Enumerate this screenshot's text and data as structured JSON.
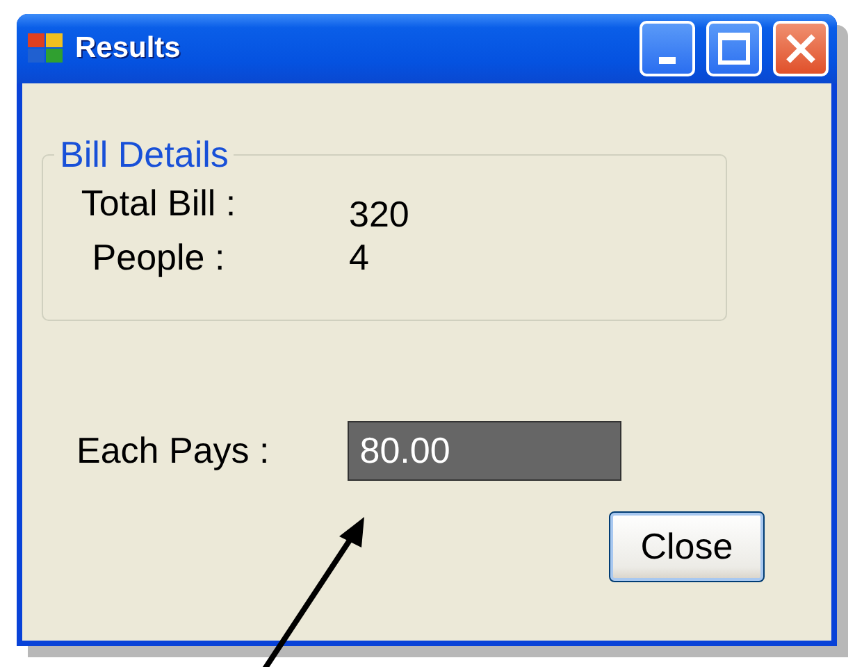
{
  "window": {
    "title": "Results"
  },
  "group": {
    "legend": "Bill Details",
    "fields": [
      {
        "label": "Total Bill :",
        "value": "320"
      },
      {
        "label": "People :",
        "value": "4"
      }
    ]
  },
  "result": {
    "label": "Each Pays :",
    "value": "80.00"
  },
  "buttons": [
    "Close"
  ]
}
